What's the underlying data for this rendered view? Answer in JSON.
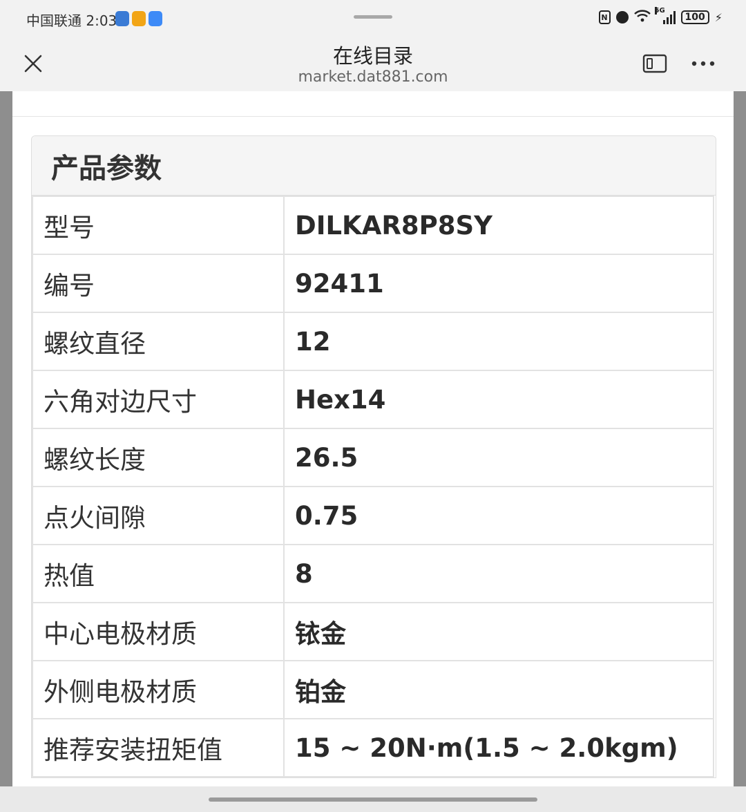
{
  "status_bar": {
    "carrier_time": "中国联通 2:03",
    "battery": "100",
    "network": "5G"
  },
  "header": {
    "title": "在线目录",
    "url": "market.dat881.com"
  },
  "params": {
    "heading": "产品参数",
    "rows": [
      {
        "label": "型号",
        "value": "DILKAR8P8SY"
      },
      {
        "label": "编号",
        "value": "92411"
      },
      {
        "label": "螺纹直径",
        "value": "12"
      },
      {
        "label": "六角对边尺寸",
        "value": "Hex14"
      },
      {
        "label": "螺纹长度",
        "value": "26.5"
      },
      {
        "label": "点火间隙",
        "value": "0.75"
      },
      {
        "label": "热值",
        "value": "8"
      },
      {
        "label": "中心电极材质",
        "value": "铱金"
      },
      {
        "label": "外侧电极材质",
        "value": "铂金"
      },
      {
        "label": "推荐安装扭矩值",
        "value": "15 ~ 20N·m(1.5 ~ 2.0kgm)"
      }
    ]
  },
  "icons": {
    "close": "close-icon",
    "split_view": "split-view-icon",
    "more": "more-icon",
    "nfc": "nfc-icon",
    "alarm": "alarm-icon",
    "wifi": "wifi-icon",
    "signal": "signal-icon",
    "battery": "battery-icon",
    "charging": "charging-bolt-icon"
  },
  "colors": {
    "header_bg": "#f2f2f2",
    "panel_heading_bg": "#f5f5f5",
    "border": "#e2e2e2",
    "side_gutter": "#8e8e8e",
    "app_badge_1": "#3a7bd5",
    "app_badge_2": "#f2a516",
    "app_badge_3": "#3d8af7"
  }
}
